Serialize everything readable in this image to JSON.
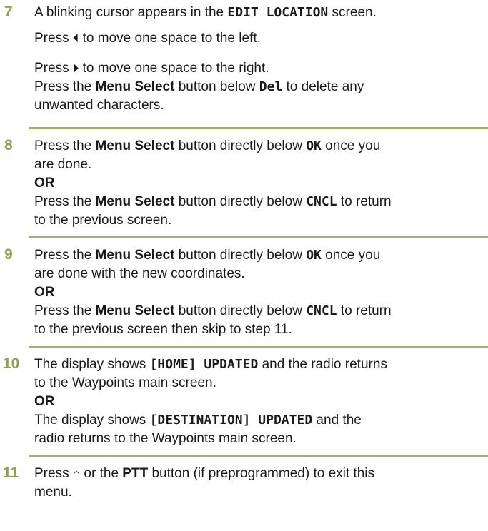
{
  "colors": {
    "step_number": "#8aa447",
    "rule": "#a2b46a"
  },
  "icons": {
    "left_arrow": "left-arrow-icon",
    "right_arrow": "right-arrow-icon",
    "home": "home-icon"
  },
  "step7": {
    "number": "7",
    "l1a": "A blinking cursor appears in the ",
    "l1b": "EDIT LOCATION",
    "l1c": " screen.",
    "l2a": "Press ",
    "l2glyph": "⏴",
    "l2c": " to move one space to the left.",
    "l3a": "Press ",
    "l3glyph": "⏵",
    "l3c": " to move one space to the right.",
    "l4a": "Press the ",
    "l4b": "Menu Select",
    "l4c": " button below ",
    "l4d": "Del",
    "l4e": " to delete any",
    "l5": "unwanted characters."
  },
  "step8": {
    "number": "8",
    "l1a": "Press the ",
    "l1b": "Menu Select",
    "l1c": " button directly below ",
    "l1d": "OK",
    "l1e": " once you",
    "l2": "are done.",
    "or": "OR",
    "l3a": "Press the ",
    "l3b": "Menu Select",
    "l3c": " button directly below ",
    "l3d": "CNCL",
    "l3e": " to return",
    "l4": "to the previous screen."
  },
  "step9": {
    "number": "9",
    "l1a": "Press the ",
    "l1b": "Menu Select",
    "l1c": " button directly below ",
    "l1d": "OK",
    "l1e": " once you",
    "l2": "are done with the new coordinates.",
    "or": "OR",
    "l3a": "Press the ",
    "l3b": "Menu Select",
    "l3c": " button directly below ",
    "l3d": "CNCL",
    "l3e": " to return",
    "l4": "to the previous screen then skip to step 11."
  },
  "step10": {
    "number": "10",
    "l1a": "The display shows ",
    "l1b": "[HOME] UPDATED",
    "l1c": " and the radio returns",
    "l2": "to the Waypoints main screen.",
    "or": "OR",
    "l3a": "The display shows ",
    "l3b": "[DESTINATION] UPDATED",
    "l3c": " and the",
    "l4": "radio returns to the Waypoints main screen."
  },
  "step11": {
    "number": "11",
    "l1a": "Press ",
    "l1glyph": "⌂",
    "l1c": " or the ",
    "l1d": "PTT",
    "l1e": " button (if preprogrammed) to exit this",
    "l2": "menu."
  }
}
